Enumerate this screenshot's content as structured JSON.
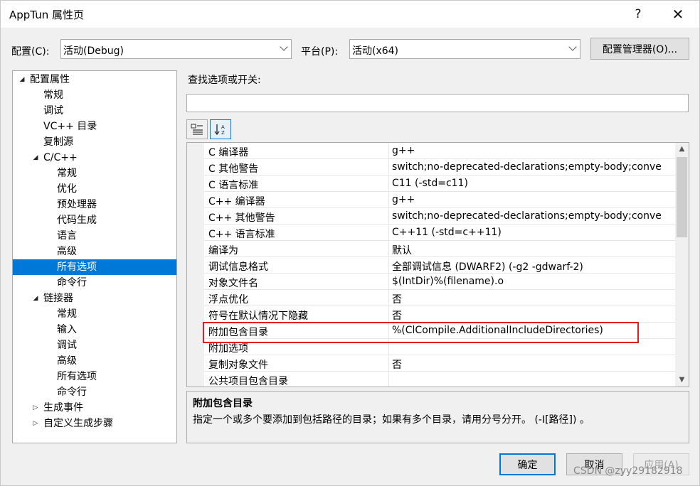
{
  "window": {
    "title": "AppTun 属性页",
    "help_glyph": "?",
    "close_glyph": "✕"
  },
  "config": {
    "label": "配置(C):",
    "value": "活动(Debug)",
    "platform_label": "平台(P):",
    "platform_value": "活动(x64)",
    "manager_button": "配置管理器(O)..."
  },
  "tree": {
    "items": [
      {
        "label": "配置属性",
        "level": 0,
        "toggle": "◢"
      },
      {
        "label": "常规",
        "level": 1
      },
      {
        "label": "调试",
        "level": 1
      },
      {
        "label": "VC++ 目录",
        "level": 1
      },
      {
        "label": "复制源",
        "level": 1
      },
      {
        "label": "C/C++",
        "level": 1,
        "toggle": "◢"
      },
      {
        "label": "常规",
        "level": 2
      },
      {
        "label": "优化",
        "level": 2
      },
      {
        "label": "预处理器",
        "level": 2
      },
      {
        "label": "代码生成",
        "level": 2
      },
      {
        "label": "语言",
        "level": 2
      },
      {
        "label": "高级",
        "level": 2
      },
      {
        "label": "所有选项",
        "level": 2,
        "selected": true
      },
      {
        "label": "命令行",
        "level": 2
      },
      {
        "label": "链接器",
        "level": 1,
        "toggle": "◢"
      },
      {
        "label": "常规",
        "level": 2
      },
      {
        "label": "输入",
        "level": 2
      },
      {
        "label": "调试",
        "level": 2
      },
      {
        "label": "高级",
        "level": 2
      },
      {
        "label": "所有选项",
        "level": 2
      },
      {
        "label": "命令行",
        "level": 2
      },
      {
        "label": "生成事件",
        "level": 1,
        "toggle": "▷"
      },
      {
        "label": "自定义生成步骤",
        "level": 1,
        "toggle": "▷"
      }
    ]
  },
  "search": {
    "label": "查找选项或开关:",
    "value": ""
  },
  "toolbar": {
    "categorized_icon": "categorized-icon",
    "alphabetical_icon": "sort-az-icon"
  },
  "grid": {
    "rows": [
      {
        "name": "C 编译器",
        "value": "g++"
      },
      {
        "name": "C 其他警告",
        "value": "switch;no-deprecated-declarations;empty-body;conve"
      },
      {
        "name": "C 语言标准",
        "value": "C11 (-std=c11)"
      },
      {
        "name": "C++ 编译器",
        "value": "g++"
      },
      {
        "name": "C++ 其他警告",
        "value": "switch;no-deprecated-declarations;empty-body;conve"
      },
      {
        "name": "C++ 语言标准",
        "value": "C++11 (-std=c++11)"
      },
      {
        "name": "编译为",
        "value": "默认"
      },
      {
        "name": "调试信息格式",
        "value": "全部调试信息 (DWARF2) (-g2 -gdwarf-2)"
      },
      {
        "name": "对象文件名",
        "value": "$(IntDir)%(filename).o"
      },
      {
        "name": "浮点优化",
        "value": "否"
      },
      {
        "name": "符号在默认情况下隐藏",
        "value": "否"
      },
      {
        "name": "附加包含目录",
        "value": "%(ClCompile.AdditionalIncludeDirectories)"
      },
      {
        "name": "附加选项",
        "value": ""
      },
      {
        "name": "复制对象文件",
        "value": "否"
      },
      {
        "name": "公共项目包含目录",
        "value": ""
      }
    ]
  },
  "description": {
    "title": "附加包含目录",
    "text": "指定一个或多个要添加到包括路径的目录；如果有多个目录，请用分号分开。 (-I[路径]) 。"
  },
  "buttons": {
    "ok": "确定",
    "cancel": "取消",
    "apply": "应用(A)"
  },
  "watermark": "CSDN @zyy29182918",
  "colors": {
    "selection": "#0078d7",
    "highlight_box": "#e02020"
  }
}
